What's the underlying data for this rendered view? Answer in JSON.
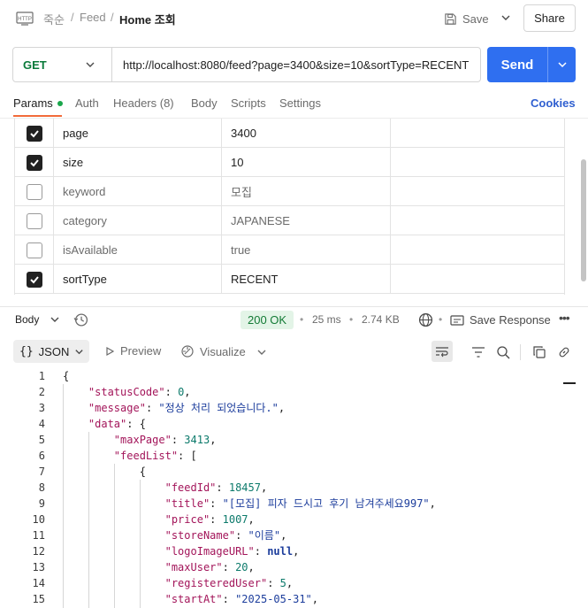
{
  "breadcrumb": {
    "workspace": "죽순",
    "collection": "Feed",
    "request": "Home 조회"
  },
  "header": {
    "save_label": "Save",
    "share_label": "Share"
  },
  "request": {
    "method": "GET",
    "url": "http://localhost:8080/feed?page=3400&size=10&sortType=RECENT",
    "send_label": "Send"
  },
  "tabs": {
    "params": "Params",
    "auth": "Auth",
    "headers": "Headers (8)",
    "body": "Body",
    "scripts": "Scripts",
    "settings": "Settings",
    "cookies": "Cookies"
  },
  "params": [
    {
      "checked": true,
      "key": "page",
      "value": "3400"
    },
    {
      "checked": true,
      "key": "size",
      "value": "10"
    },
    {
      "checked": false,
      "key": "keyword",
      "value": "모집"
    },
    {
      "checked": false,
      "key": "category",
      "value": "JAPANESE"
    },
    {
      "checked": false,
      "key": "isAvailable",
      "value": "true"
    },
    {
      "checked": true,
      "key": "sortType",
      "value": "RECENT"
    }
  ],
  "response": {
    "body_label": "Body",
    "status": "200 OK",
    "time": "25 ms",
    "size": "2.74 KB",
    "save_response": "Save Response",
    "format": "JSON",
    "preview": "Preview",
    "visualize": "Visualize"
  },
  "code_lines": [
    {
      "n": "1"
    },
    {
      "n": "2"
    },
    {
      "n": "3"
    },
    {
      "n": "4"
    },
    {
      "n": "5"
    },
    {
      "n": "6"
    },
    {
      "n": "7"
    },
    {
      "n": "8"
    },
    {
      "n": "9"
    },
    {
      "n": "10"
    },
    {
      "n": "11"
    },
    {
      "n": "12"
    },
    {
      "n": "13"
    },
    {
      "n": "14"
    },
    {
      "n": "15"
    }
  ],
  "json": {
    "statusCode_key": "\"statusCode\"",
    "statusCode_val": "0",
    "message_key": "\"message\"",
    "message_val": "\"정상 처리 되었습니다.\"",
    "data_key": "\"data\"",
    "maxPage_key": "\"maxPage\"",
    "maxPage_val": "3413",
    "feedList_key": "\"feedList\"",
    "feedId_key": "\"feedId\"",
    "feedId_val": "18457",
    "title_key": "\"title\"",
    "title_val": "\"[모집] 피자 드시고 후기 남겨주세요997\"",
    "price_key": "\"price\"",
    "price_val": "1007",
    "storeName_key": "\"storeName\"",
    "storeName_val": "\"이름\"",
    "logo_key": "\"logoImageURL\"",
    "logo_val": "null",
    "maxUser_key": "\"maxUser\"",
    "maxUser_val": "20",
    "registeredUser_key": "\"registeredUser\"",
    "registeredUser_val": "5",
    "startAt_key": "\"startAt\"",
    "startAt_val": "\"2025-05-31\""
  }
}
